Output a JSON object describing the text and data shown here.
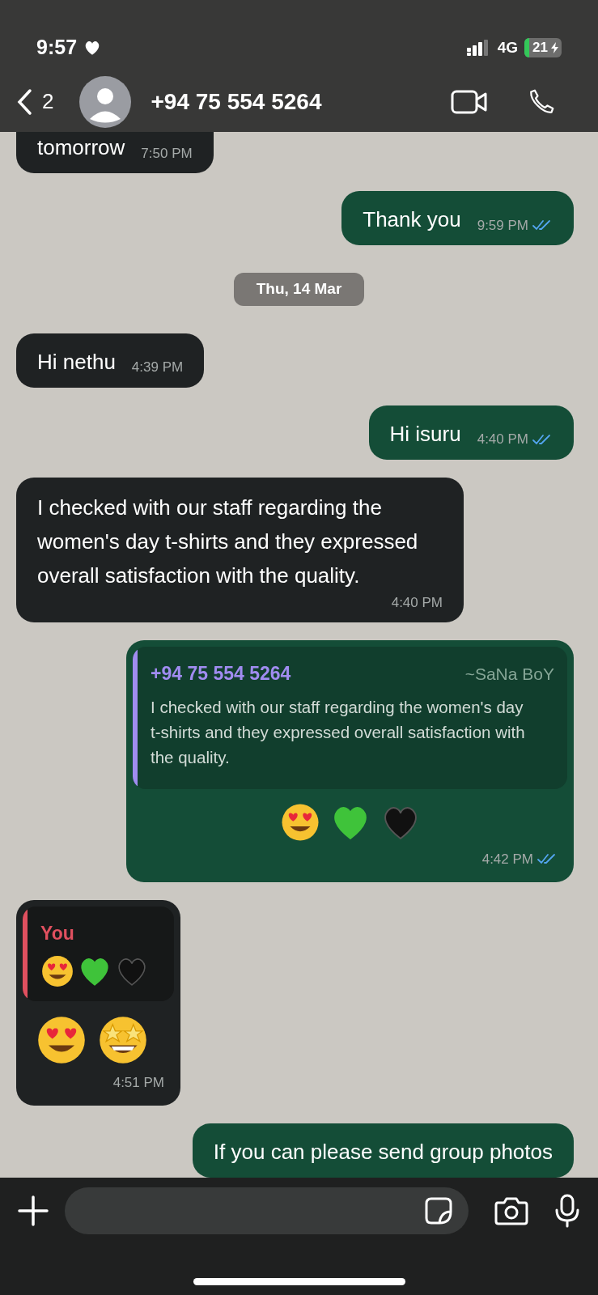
{
  "status_bar": {
    "time": "9:57",
    "network": "4G",
    "battery": "21"
  },
  "header": {
    "back_count": "2",
    "contact": "+94 75 554 5264"
  },
  "messages": [
    {
      "kind": "text",
      "outgoing": false,
      "text": "tomorrow",
      "time": "7:50 PM"
    },
    {
      "kind": "text",
      "outgoing": true,
      "text": "Thank you",
      "time": "9:59 PM",
      "read": true
    },
    {
      "kind": "date",
      "text": "Thu, 14 Mar"
    },
    {
      "kind": "text",
      "outgoing": false,
      "text": "Hi nethu",
      "time": "4:39 PM"
    },
    {
      "kind": "text",
      "outgoing": true,
      "text": "Hi isuru",
      "time": "4:40 PM",
      "read": true
    },
    {
      "kind": "text",
      "outgoing": false,
      "text": "I checked with our staff regarding the women's day t-shirts and they expressed overall satisfaction with the quality.",
      "time": "4:40 PM"
    },
    {
      "kind": "quote",
      "outgoing": true,
      "quote": {
        "author": "+94 75 554 5264",
        "name": "~SaNa BoY",
        "color": "#a08cf0",
        "text": "I checked with our staff regarding the women's day t-shirts and they expressed overall satisfaction with the quality."
      },
      "emojis": [
        {
          "kind": "heart_eyes"
        },
        {
          "kind": "green_heart"
        },
        {
          "kind": "black_heart"
        }
      ],
      "time": "4:42 PM",
      "read": true
    },
    {
      "kind": "quote",
      "outgoing": false,
      "quote": {
        "author": "You",
        "color": "#e0505f",
        "emojis": [
          {
            "kind": "heart_eyes"
          },
          {
            "kind": "green_heart"
          },
          {
            "kind": "black_heart"
          }
        ]
      },
      "emojis": [
        {
          "kind": "heart_eyes"
        },
        {
          "kind": "star_struck"
        }
      ],
      "time": "4:51 PM"
    },
    {
      "kind": "text",
      "outgoing": true,
      "text": "If you can please send group photos"
    }
  ]
}
